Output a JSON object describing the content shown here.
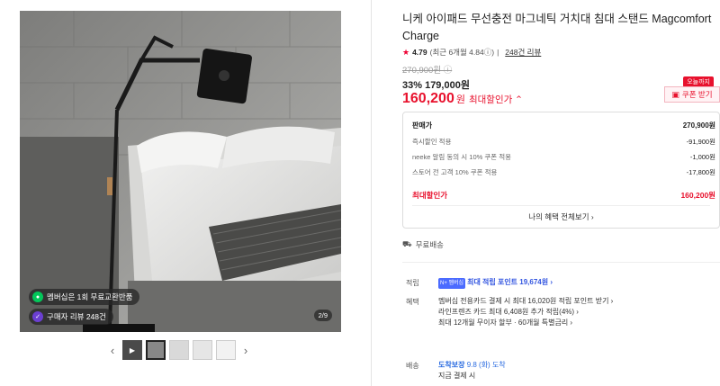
{
  "product": {
    "title": "니케 아이패드 무선충전 마그네틱 거치대 침대 스탠드 Magcomfort Charge",
    "rating": "4.79",
    "rating_sub": "(최근 6개월 4.84ⓘ)",
    "review_count": "248건 리뷰",
    "original_price": "270,900원 ⓘ",
    "discount_line": "33% 179,000원",
    "final_price": "160,200",
    "final_unit": "원",
    "final_label": "최대할인가 ⌃",
    "today_badge": "오늘까지",
    "coupon_label": "쿠폰 받기"
  },
  "gallery": {
    "chip1": "멤버십은 1회 무료교환반품",
    "chip2": "구매자 리뷰 248건",
    "counter": "2/9",
    "prev": "‹",
    "next": "›"
  },
  "price_box": {
    "rows": [
      {
        "label": "판매가",
        "value": "270,900원"
      },
      {
        "label": "즉시할인 적용",
        "value": "-91,900원"
      },
      {
        "label": "neeke 알림 동의 시 10% 쿠폰 적용",
        "value": "-1,000원"
      },
      {
        "label": "스토어 전 고객 10% 쿠폰 적용",
        "value": "-17,800원"
      }
    ],
    "best_label": "최대할인가",
    "best_value": "160,200원",
    "my_benefit": "나의 혜택 전체보기 ›"
  },
  "shipping": {
    "text": "무료배송"
  },
  "benefits": {
    "point_label": "적립",
    "point_badge": "N+ 멤버십",
    "point_text": "최대 적립 포인트 19,674원 ›",
    "benefit_label": "혜택",
    "benefit_lines": [
      "멤버십 전용카드 결제 시 최대 16,020원 적립 포인트 받기 ›",
      "라인프렌즈 카드 최대 6,408원 추가 적립(4%) ›",
      "최대 12개월 무이자 할부 · 60개월 특별금리 ›"
    ],
    "delivery_label": "배송",
    "delivery_tag": "도착보장",
    "delivery_date": "9.8 (화) 도착",
    "delivery_sub": "지금 결제 시"
  },
  "colors": {
    "accent": "#e8112d",
    "npay": "#03c75a"
  }
}
